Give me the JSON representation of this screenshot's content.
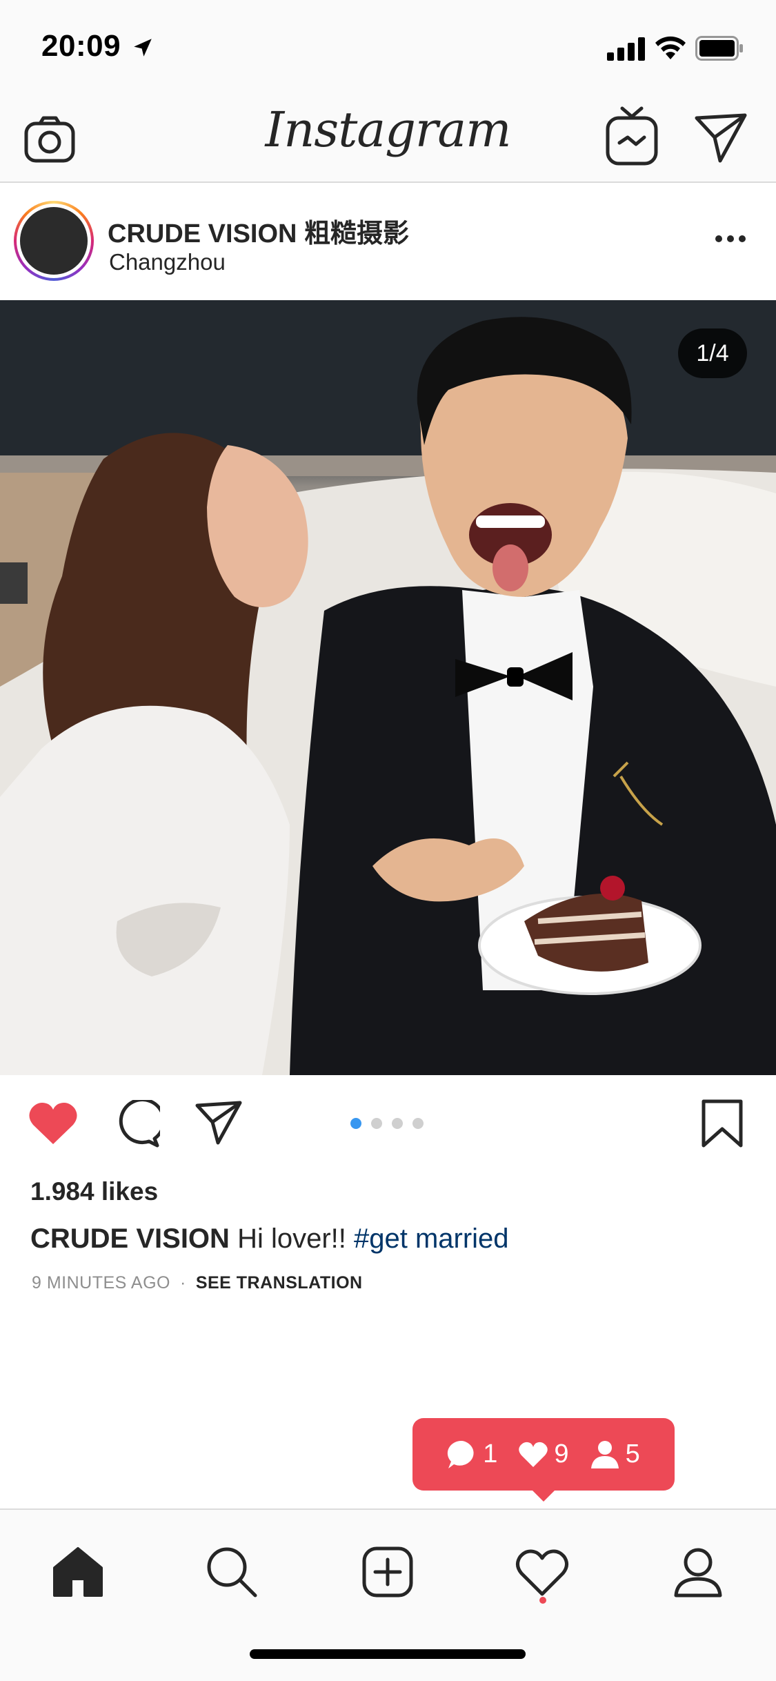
{
  "status_bar": {
    "time": "20:09",
    "icons": [
      "location-arrow-icon",
      "signal-icon",
      "wifi-icon",
      "battery-icon"
    ]
  },
  "nav": {
    "logo": "Instagram",
    "icons": [
      "camera-icon",
      "igtv-icon",
      "direct-send-icon"
    ]
  },
  "post": {
    "username": "CRUDE VISION 粗糙摄影",
    "location": "Changzhou",
    "page_counter": "1/4",
    "carousel": {
      "count": 4,
      "active_index": 0
    },
    "liked": true,
    "likes": "1.984 likes",
    "caption": {
      "user": "CRUDE VISION",
      "text": "Hi lover!!",
      "hashtag": "#get married"
    },
    "time_ago": "9 MINUTES AGO",
    "separator": "·",
    "see_translation": "SEE TRANSLATION"
  },
  "activity": {
    "comments": "1",
    "likes": "9",
    "follows": "5"
  },
  "colors": {
    "like_red": "#ed4956",
    "active_dot": "#3897f0",
    "hashtag": "#003569",
    "text": "#262626",
    "muted": "#8e8e8e"
  },
  "tabs": [
    "home-icon",
    "search-icon",
    "add-post-icon",
    "activity-heart-icon",
    "profile-icon"
  ]
}
